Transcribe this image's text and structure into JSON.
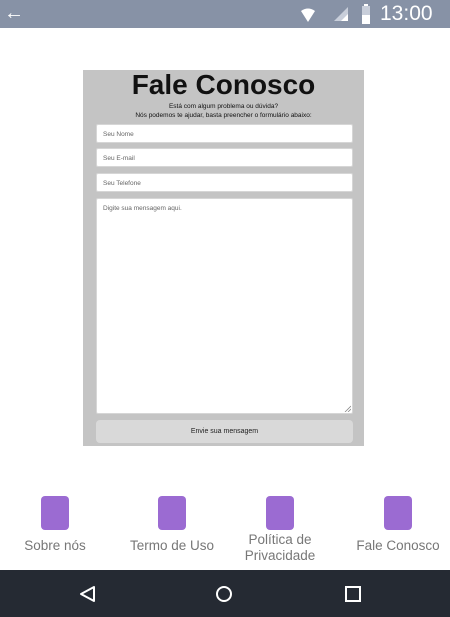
{
  "status_bar": {
    "time": "13:00",
    "icons": [
      "back-arrow-icon",
      "wifi-icon",
      "signal-icon",
      "battery-icon"
    ]
  },
  "form": {
    "title": "Fale Conosco",
    "subtitle_line1": "Está com algum problema ou dúvida?",
    "subtitle_line2": "Nós podemos te ajudar, basta preencher o formulário abaixo:",
    "name_placeholder": "Seu Nome",
    "email_placeholder": "Seu E-mail",
    "phone_placeholder": "Seu Telefone",
    "message_placeholder": "Digite sua mensagem aqui.",
    "submit_label": "Envie sua mensagem"
  },
  "nav_items": [
    {
      "label": "Sobre nós"
    },
    {
      "label": "Termo de Uso"
    },
    {
      "label": "Política de Privacidade"
    },
    {
      "label": "Fale Conosco"
    }
  ],
  "colors": {
    "status_bar": "#8792a6",
    "card": "#c4c4c4",
    "nav_icon": "#9b6bd2",
    "system_nav": "#252a33"
  }
}
